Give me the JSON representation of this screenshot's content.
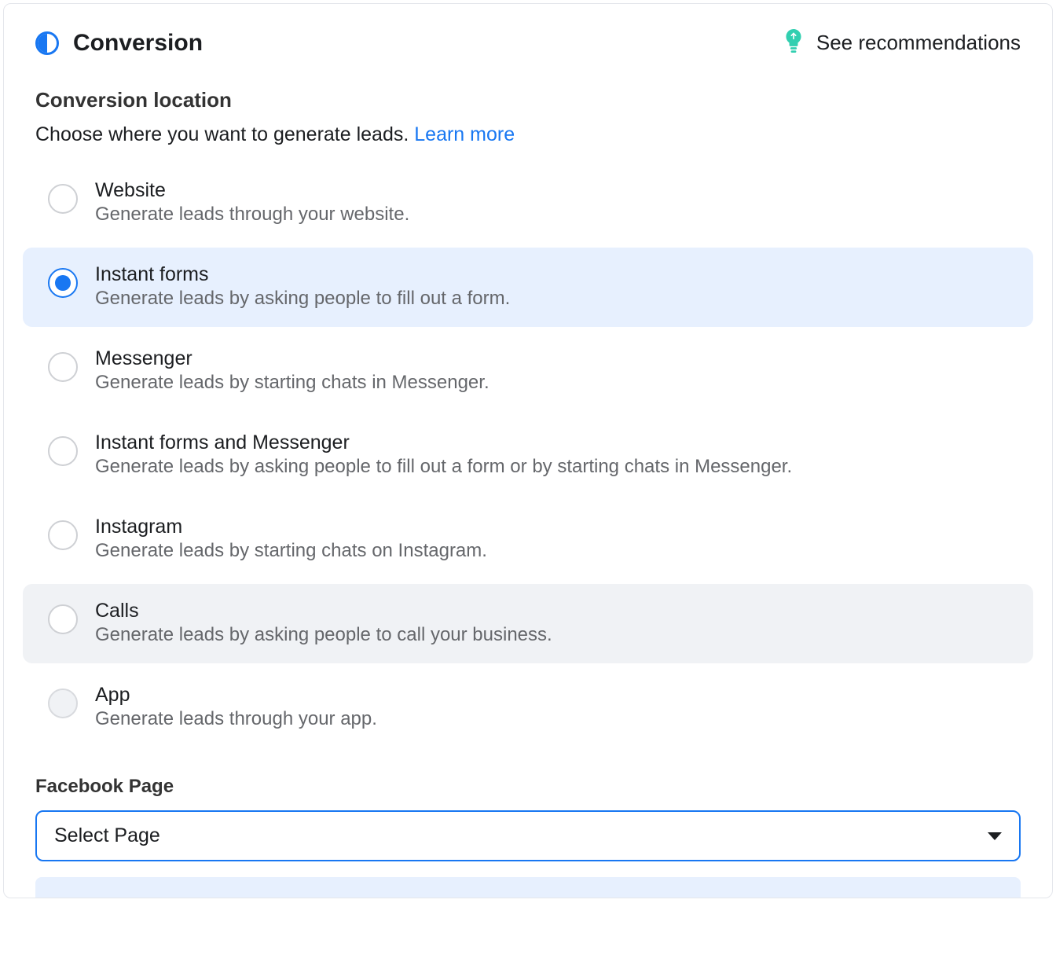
{
  "header": {
    "title": "Conversion",
    "recommendations_label": "See recommendations"
  },
  "conversion_location": {
    "title": "Conversion location",
    "description": "Choose where you want to generate leads. ",
    "learn_more": "Learn more",
    "options": [
      {
        "title": "Website",
        "description": "Generate leads through your website.",
        "selected": false,
        "hover": false,
        "disabled": false
      },
      {
        "title": "Instant forms",
        "description": "Generate leads by asking people to fill out a form.",
        "selected": true,
        "hover": false,
        "disabled": false
      },
      {
        "title": "Messenger",
        "description": "Generate leads by starting chats in Messenger.",
        "selected": false,
        "hover": false,
        "disabled": false
      },
      {
        "title": "Instant forms and Messenger",
        "description": "Generate leads by asking people to fill out a form or by starting chats in Messenger.",
        "selected": false,
        "hover": false,
        "disabled": false
      },
      {
        "title": "Instagram",
        "description": "Generate leads by starting chats on Instagram.",
        "selected": false,
        "hover": false,
        "disabled": false
      },
      {
        "title": "Calls",
        "description": "Generate leads by asking people to call your business.",
        "selected": false,
        "hover": true,
        "disabled": false
      },
      {
        "title": "App",
        "description": "Generate leads through your app.",
        "selected": false,
        "hover": false,
        "disabled": true
      }
    ]
  },
  "facebook_page": {
    "title": "Facebook Page",
    "select_label": "Select Page"
  }
}
